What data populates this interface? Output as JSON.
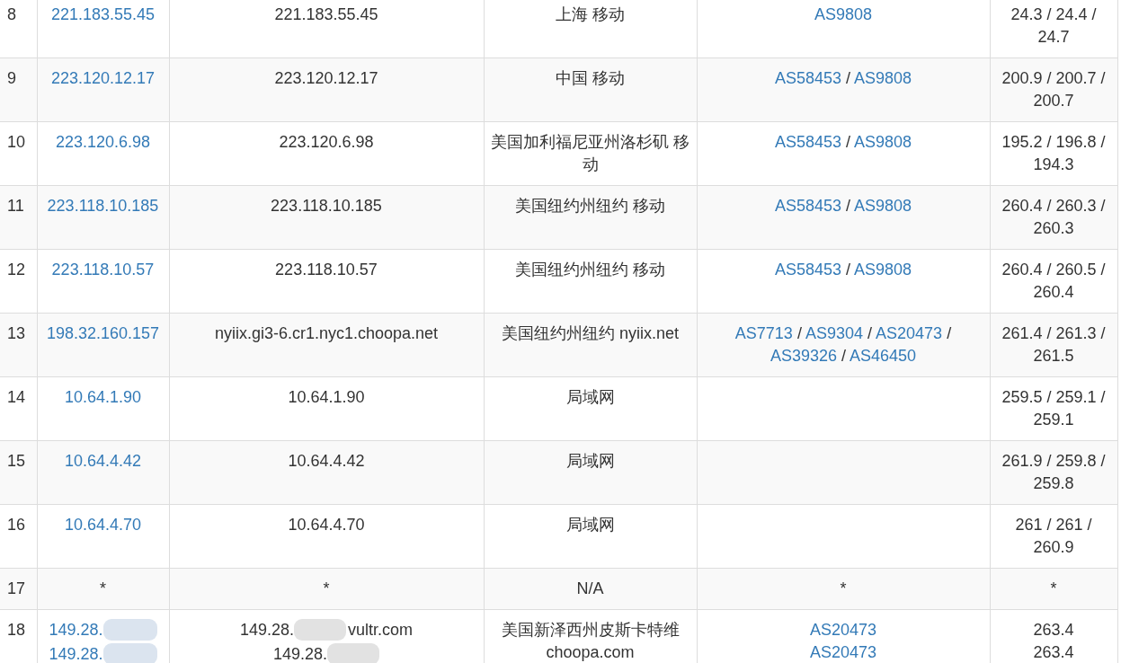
{
  "table": {
    "rows": [
      {
        "kind": "hop",
        "hop": "8",
        "ips": [
          {
            "text": "221.183.55.45",
            "redacted": false
          }
        ],
        "hosts": [
          {
            "text": "221.183.55.45",
            "redacted": false
          }
        ],
        "location": "上海 移动",
        "asn": [
          {
            "items": [
              "AS9808"
            ]
          }
        ],
        "latency": [
          "24.3 / 24.4 / 24.7"
        ]
      },
      {
        "kind": "hop",
        "hop": "9",
        "ips": [
          {
            "text": "223.120.12.17",
            "redacted": false
          }
        ],
        "hosts": [
          {
            "text": "223.120.12.17",
            "redacted": false
          }
        ],
        "location": "中国 移动",
        "asn": [
          {
            "items": [
              "AS58453",
              "AS9808"
            ],
            "separator": "/"
          }
        ],
        "latency": [
          "200.9 / 200.7 / 200.7"
        ]
      },
      {
        "kind": "hop",
        "hop": "10",
        "ips": [
          {
            "text": "223.120.6.98",
            "redacted": false
          }
        ],
        "hosts": [
          {
            "text": "223.120.6.98",
            "redacted": false
          }
        ],
        "location": "美国加利福尼亚州洛杉矶 移动",
        "asn": [
          {
            "items": [
              "AS58453",
              "AS9808"
            ],
            "separator": "/"
          }
        ],
        "latency": [
          "195.2 / 196.8 / 194.3"
        ]
      },
      {
        "kind": "hop",
        "hop": "11",
        "ips": [
          {
            "text": "223.118.10.185",
            "redacted": false
          }
        ],
        "hosts": [
          {
            "text": "223.118.10.185",
            "redacted": false
          }
        ],
        "location": "美国纽约州纽约 移动",
        "asn": [
          {
            "items": [
              "AS58453",
              "AS9808"
            ],
            "separator": "/"
          }
        ],
        "latency": [
          "260.4 / 260.3 / 260.3"
        ]
      },
      {
        "kind": "hop",
        "hop": "12",
        "ips": [
          {
            "text": "223.118.10.57",
            "redacted": false
          }
        ],
        "hosts": [
          {
            "text": "223.118.10.57",
            "redacted": false
          }
        ],
        "location": "美国纽约州纽约 移动",
        "asn": [
          {
            "items": [
              "AS58453",
              "AS9808"
            ],
            "separator": "/"
          }
        ],
        "latency": [
          "260.4 / 260.5 / 260.4"
        ]
      },
      {
        "kind": "hop",
        "hop": "13",
        "ips": [
          {
            "text": "198.32.160.157",
            "redacted": false
          }
        ],
        "hosts": [
          {
            "text": "nyiix.gi3-6.cr1.nyc1.choopa.net",
            "redacted": false
          }
        ],
        "location": "美国纽约州纽约 nyiix.net",
        "asn": [
          {
            "items": [
              "AS7713",
              "AS9304",
              "AS20473",
              "AS39326",
              "AS46450"
            ],
            "separator": "/"
          }
        ],
        "latency": [
          "261.4 / 261.3 / 261.5"
        ]
      },
      {
        "kind": "hop",
        "hop": "14",
        "ips": [
          {
            "text": "10.64.1.90",
            "redacted": false
          }
        ],
        "hosts": [
          {
            "text": "10.64.1.90",
            "redacted": false
          }
        ],
        "location": "局域网",
        "latency": [
          "259.5 / 259.1 / 259.1"
        ]
      },
      {
        "kind": "hop",
        "hop": "15",
        "ips": [
          {
            "text": "10.64.4.42",
            "redacted": false
          }
        ],
        "hosts": [
          {
            "text": "10.64.4.42",
            "redacted": false
          }
        ],
        "location": "局域网",
        "latency": [
          "261.9 / 259.8 / 259.8"
        ]
      },
      {
        "kind": "hop",
        "hop": "16",
        "ips": [
          {
            "text": "10.64.4.70",
            "redacted": false
          }
        ],
        "hosts": [
          {
            "text": "10.64.4.70",
            "redacted": false
          }
        ],
        "location": "局域网",
        "latency": [
          "261 / 261 / 260.9"
        ]
      },
      {
        "kind": "timeout",
        "hop": "17",
        "ips": [
          {
            "text": "*",
            "redacted": false
          }
        ],
        "hosts": [
          {
            "text": "*",
            "redacted": false
          }
        ],
        "location": "N/A",
        "asn": [
          {
            "items": [
              "*"
            ]
          }
        ],
        "latency": [
          "*"
        ]
      },
      {
        "kind": "hop",
        "hop": "18",
        "ips": [
          {
            "text": "149.28.",
            "redacted": true
          },
          {
            "text": "149.28.",
            "redacted": true
          }
        ],
        "hosts": [
          {
            "text": "149.28.",
            "redacted": true,
            "suffix": "vultr.com"
          },
          {
            "text": "149.28.",
            "redacted": true
          }
        ],
        "location": "美国新泽西州皮斯卡特维 choopa.com",
        "asn": [
          {
            "items": [
              "AS20473"
            ]
          },
          {
            "items": [
              "AS20473"
            ]
          }
        ],
        "latency": [
          "263.4",
          "263.4"
        ]
      }
    ]
  }
}
